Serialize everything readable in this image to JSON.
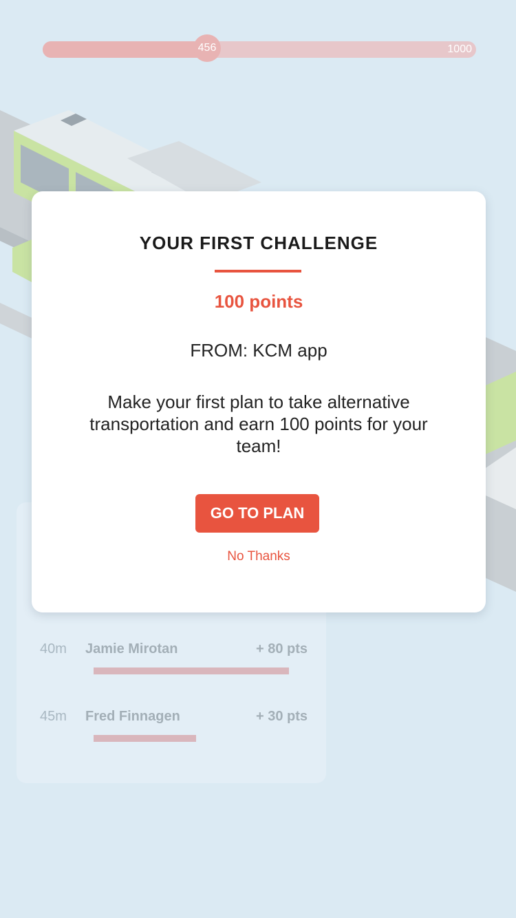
{
  "progress": {
    "current": "456",
    "max": "1000",
    "fraction": 0.38,
    "fill_color": "#e8b3b3",
    "track_color": "#e7c7ca"
  },
  "leaderboard": {
    "rows": [
      {
        "time": "40m",
        "name": "Jamie Mirotan",
        "points": "+ 80 pts",
        "bar_fraction": 0.86
      },
      {
        "time": "45m",
        "name": "Fred Finnagen",
        "points": "+ 30 pts",
        "bar_fraction": 0.45
      }
    ]
  },
  "modal": {
    "title": "YOUR FIRST CHALLENGE",
    "points": "100 points",
    "from": "FROM:  KCM app",
    "body": "Make your first plan to take alternative transportation and earn 100 points for your team!",
    "primary_button": "GO TO PLAN",
    "secondary_link": "No Thanks",
    "accent_color": "#e8543f"
  },
  "illustration": {
    "icon": "isometric-street-bus-cars-illustration"
  }
}
